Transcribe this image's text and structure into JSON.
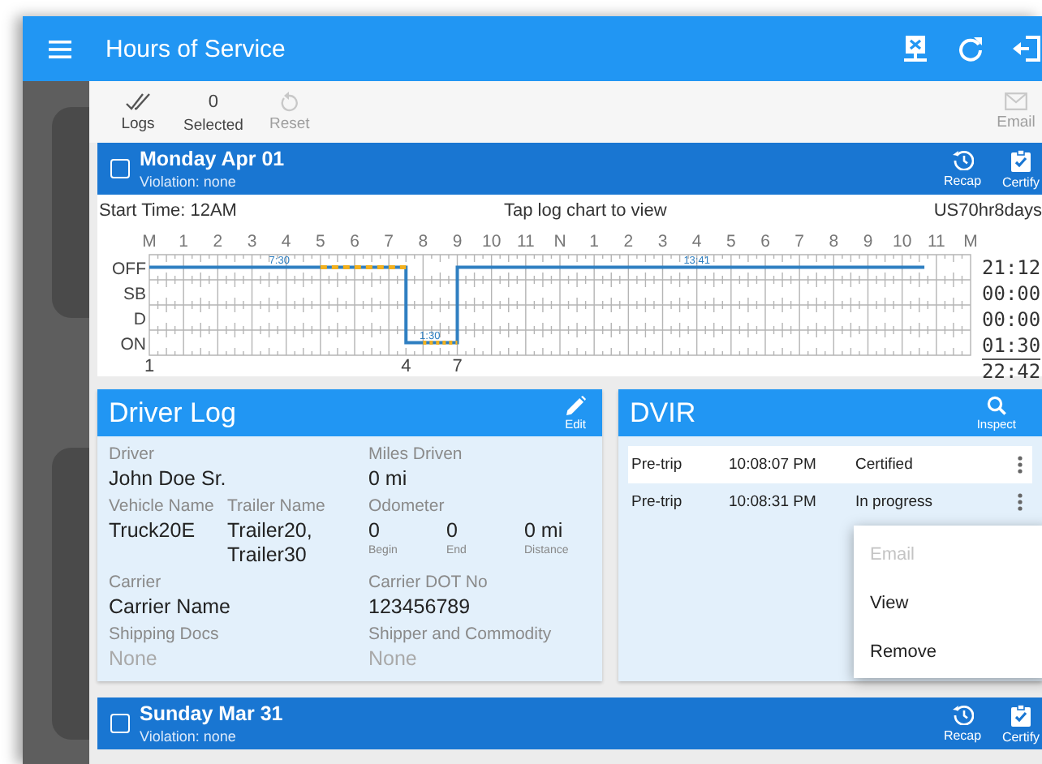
{
  "app_bar": {
    "title": "Hours of Service"
  },
  "toolbar": {
    "items": [
      {
        "kind": "logs",
        "label": "Logs",
        "disabled": false
      },
      {
        "kind": "count",
        "count": "0",
        "label": "Selected",
        "disabled": false
      },
      {
        "kind": "reset",
        "label": "Reset",
        "disabled": true
      },
      {
        "kind": "email",
        "label": "Email",
        "disabled": true
      }
    ]
  },
  "days": [
    {
      "title": "Monday Apr 01",
      "violation": "Violation: none",
      "checked": false,
      "actions": [
        {
          "kind": "recap",
          "label": "Recap"
        },
        {
          "kind": "certify",
          "label": "Certify"
        }
      ],
      "log": {
        "start_time": "Start Time: 12AM",
        "hint": "Tap log chart to view",
        "ruleset": "US70hr8days",
        "hour_labels": [
          "M",
          "1",
          "2",
          "3",
          "4",
          "5",
          "6",
          "7",
          "8",
          "9",
          "10",
          "11",
          "N",
          "1",
          "2",
          "3",
          "4",
          "5",
          "6",
          "7",
          "8",
          "9",
          "10",
          "11",
          "M"
        ],
        "status_labels": [
          "OFF",
          "SB",
          "D",
          "ON"
        ],
        "duration_labels": [
          "7:30",
          "1:30",
          "13:41"
        ],
        "event_numbers": [
          "1",
          "4",
          "7"
        ],
        "totals": [
          "21:12",
          "00:00",
          "00:00",
          "01:30"
        ],
        "total": "22:42"
      },
      "driver_log": {
        "title": "Driver Log",
        "edit_label": "Edit",
        "rows": [
          {
            "cells": [
              {
                "kind": "field",
                "label": "Driver",
                "value": "John Doe Sr.",
                "muted": false
              },
              {
                "kind": "field",
                "label": "Miles Driven",
                "value": "0 mi",
                "muted": false
              }
            ]
          },
          {
            "cells": [
              {
                "kind": "pair",
                "fields": [
                  {
                    "label": "Vehicle Name",
                    "value": "Truck20E",
                    "muted": false
                  },
                  {
                    "label": "Trailer Name",
                    "value": "Trailer20, Trailer30",
                    "muted": false
                  }
                ]
              },
              {
                "kind": "odometer",
                "label": "Odometer",
                "parts": [
                  {
                    "value": "0",
                    "caption": "Begin"
                  },
                  {
                    "value": "0",
                    "caption": "End"
                  },
                  {
                    "value": "0 mi",
                    "caption": "Distance"
                  }
                ]
              }
            ]
          },
          {
            "cells": [
              {
                "kind": "field",
                "label": "Carrier",
                "value": "Carrier Name",
                "muted": false
              },
              {
                "kind": "field",
                "label": "Carrier DOT No",
                "value": "123456789",
                "muted": false
              }
            ]
          },
          {
            "cells": [
              {
                "kind": "field",
                "label": "Shipping Docs",
                "value": "None",
                "muted": true
              },
              {
                "kind": "field",
                "label": "Shipper and Commodity",
                "value": "None",
                "muted": true
              }
            ]
          }
        ]
      },
      "dvir": {
        "title": "DVIR",
        "inspect_label": "Inspect",
        "reports": [
          {
            "type": "Pre-trip",
            "time": "10:08:07 PM",
            "status": "Certified",
            "selected": true
          },
          {
            "type": "Pre-trip",
            "time": "10:08:31 PM",
            "status": "In progress",
            "selected": false,
            "menu": [
              {
                "label": "Email",
                "disabled": true
              },
              {
                "label": "View",
                "disabled": false
              },
              {
                "label": "Remove",
                "disabled": false
              }
            ]
          }
        ]
      }
    },
    {
      "title": "Sunday Mar 31",
      "violation": "Violation: none",
      "checked": false,
      "actions": [
        {
          "kind": "recap",
          "label": "Recap"
        },
        {
          "kind": "certify",
          "label": "Certify"
        }
      ]
    }
  ]
}
